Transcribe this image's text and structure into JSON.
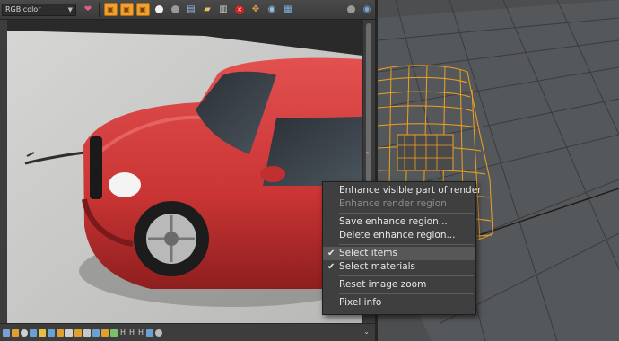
{
  "toolbar": {
    "color_mode": "RGB color",
    "icons": [
      "heart-palette-icon",
      "orange-square-icon",
      "orange-square-icon",
      "orange-square-icon",
      "white-sphere-icon",
      "grey-sphere-icon",
      "save-icon",
      "folder-icon",
      "copy-icon",
      "stop-icon",
      "move-icon",
      "eye-icon",
      "settings-icon"
    ],
    "right_icons": [
      "globe-icon",
      "eye-icon"
    ]
  },
  "context_menu": {
    "items": [
      {
        "label": "Enhance visible part of render",
        "disabled": false,
        "checked": false
      },
      {
        "label": "Enhance render region",
        "disabled": true,
        "checked": false
      },
      {
        "label": "Save enhance region...",
        "disabled": false,
        "checked": false
      },
      {
        "label": "Delete enhance region...",
        "disabled": false,
        "checked": false
      },
      {
        "label": "Select items",
        "disabled": false,
        "checked": true
      },
      {
        "label": "Select materials",
        "disabled": false,
        "checked": true
      },
      {
        "label": "Reset image zoom",
        "disabled": false,
        "checked": false
      },
      {
        "label": "Pixel info",
        "disabled": false,
        "checked": false
      }
    ]
  },
  "statusbar": {
    "labels": [
      "H",
      "H",
      "H"
    ]
  },
  "colors": {
    "car_red": "#d43a3a",
    "wireframe": "#f0a020",
    "menu_bg": "#3f3f3f"
  }
}
